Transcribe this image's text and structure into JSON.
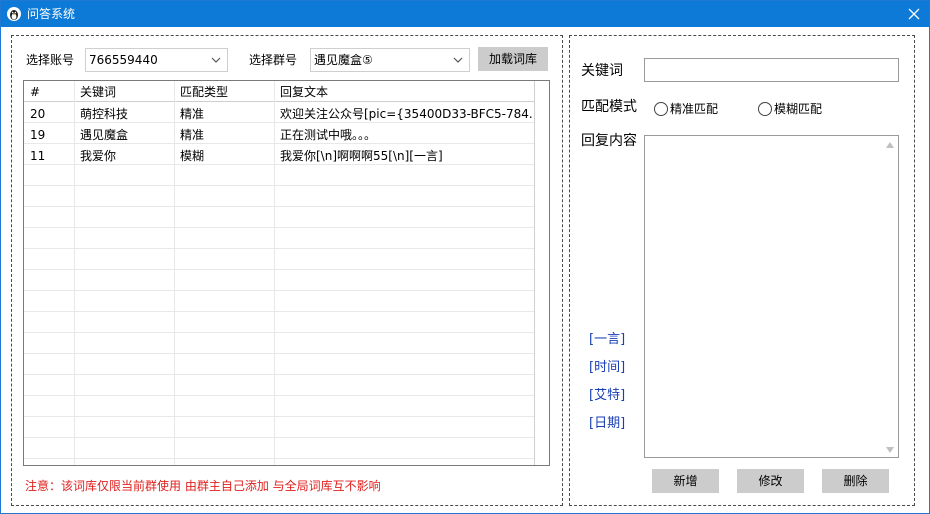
{
  "window": {
    "title": "问答系统"
  },
  "left": {
    "account_label": "选择账号",
    "account_value": "766559440",
    "group_label": "选择群号",
    "group_value": "遇见魔盒⑤",
    "load_button": "加载词库",
    "table": {
      "columns": [
        "#",
        "关键词",
        "匹配类型",
        "回复文本"
      ],
      "rows": [
        [
          "20",
          "萌控科技",
          "精准",
          "欢迎关注公众号[pic={35400D33-BFC5-784..."
        ],
        [
          "19",
          "遇见魔盒",
          "精准",
          "正在测试中哦。。。"
        ],
        [
          "11",
          "我爱你",
          "模糊",
          "我爱你[\\n]啊啊啊55[\\n][一言]"
        ]
      ]
    },
    "notice": "注意：该词库仅限当前群使用 由群主自己添加 与全局词库互不影响"
  },
  "right": {
    "keyword_label": "关键词",
    "keyword_value": "",
    "match_label": "匹配模式",
    "radio_exact": "精准匹配",
    "radio_fuzzy": "模糊匹配",
    "reply_label": "回复内容",
    "reply_value": "",
    "vars": [
      "[一言]",
      "[时间]",
      "[艾特]",
      "[日期]"
    ],
    "buttons": {
      "add": "新增",
      "edit": "修改",
      "delete": "删除"
    }
  },
  "colors": {
    "titlebar": "#0c7ad6",
    "notice": "#e0201e",
    "link": "#1a3fb5",
    "button": "#cccccc"
  }
}
